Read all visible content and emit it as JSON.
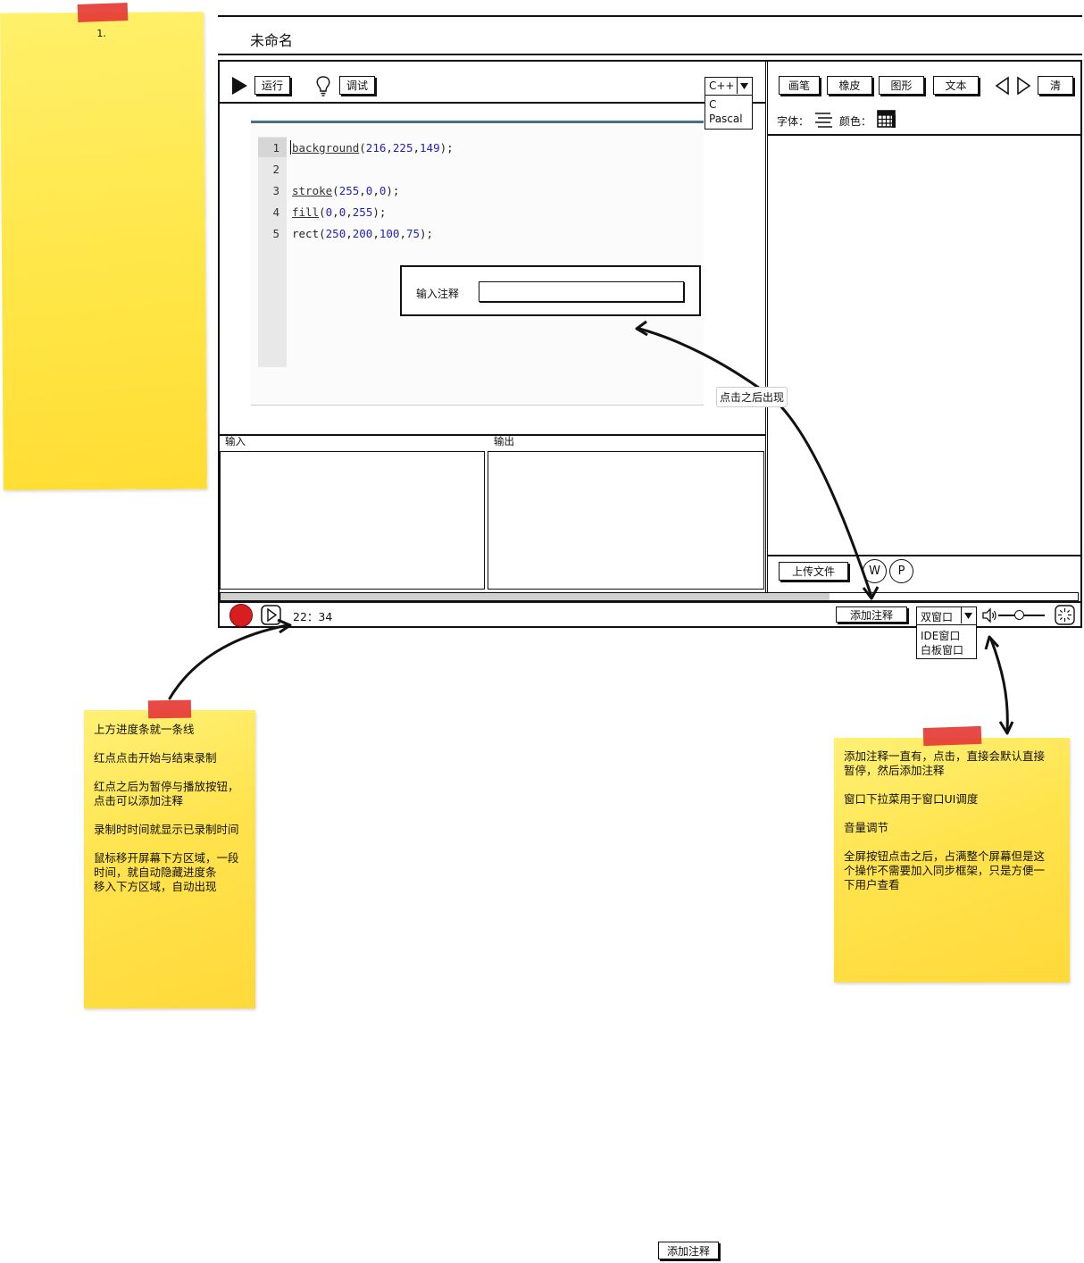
{
  "page_title": "未命名",
  "toolbar": {
    "run_label": "运行",
    "debug_label": "调试",
    "language_selected": "C++",
    "language_options": [
      "C",
      "Pascal"
    ]
  },
  "editor": {
    "line_numbers": [
      "1",
      "2",
      "3",
      "4",
      "5"
    ],
    "lines": [
      [
        {
          "t": "background",
          "c": "fn"
        },
        {
          "t": "(",
          "c": "p"
        },
        {
          "t": "216",
          "c": "num"
        },
        {
          "t": ",",
          "c": "p"
        },
        {
          "t": "225",
          "c": "num"
        },
        {
          "t": ",",
          "c": "p"
        },
        {
          "t": "149",
          "c": "num"
        },
        {
          "t": ");",
          "c": "p"
        }
      ],
      [],
      [
        {
          "t": "stroke",
          "c": "fn"
        },
        {
          "t": "(",
          "c": "p"
        },
        {
          "t": "255",
          "c": "num"
        },
        {
          "t": ",",
          "c": "p"
        },
        {
          "t": "0",
          "c": "num"
        },
        {
          "t": ",",
          "c": "p"
        },
        {
          "t": "0",
          "c": "num"
        },
        {
          "t": ");",
          "c": "p"
        }
      ],
      [
        {
          "t": "fill",
          "c": "fn"
        },
        {
          "t": "(",
          "c": "p"
        },
        {
          "t": "0",
          "c": "num"
        },
        {
          "t": ",",
          "c": "p"
        },
        {
          "t": "0",
          "c": "num"
        },
        {
          "t": ",",
          "c": "p"
        },
        {
          "t": "255",
          "c": "num"
        },
        {
          "t": ");",
          "c": "p"
        }
      ],
      [
        {
          "t": "rect",
          "c": "p"
        },
        {
          "t": "(",
          "c": "p"
        },
        {
          "t": "250",
          "c": "num"
        },
        {
          "t": ",",
          "c": "p"
        },
        {
          "t": "200",
          "c": "num"
        },
        {
          "t": ",",
          "c": "p"
        },
        {
          "t": "100",
          "c": "num"
        },
        {
          "t": ",",
          "c": "p"
        },
        {
          "t": "75",
          "c": "num"
        },
        {
          "t": ");",
          "c": "p"
        }
      ]
    ]
  },
  "annotation_popup": {
    "label": "输入注释",
    "value": ""
  },
  "callout_appear": "点击之后出现",
  "panes": {
    "input_label": "输入",
    "output_label": "输出"
  },
  "whiteboard": {
    "tools": [
      "画笔",
      "橡皮",
      "图形",
      "文本"
    ],
    "clear_label": "清",
    "font_label": "字体：",
    "color_label": "颜色：",
    "upload_label": "上传文件",
    "w_label": "W",
    "p_label": "P"
  },
  "recorder": {
    "time": "22：34",
    "add_note_label": "添加注释",
    "window_selected": "双窗口",
    "window_options": [
      "IDE窗口",
      "白板窗口"
    ],
    "progress": 0.71
  },
  "notes": {
    "top_left": "1.",
    "bottom_left": "上方进度条就一条线\n\n红点点击开始与结束录制\n\n红点之后为暂停与播放按钮，\n点击可以添加注释\n\n录制时时间就显示已录制时间\n\n鼠标移开屏幕下方区域，一段\n时间，就自动隐藏进度条\n移入下方区域，自动出现",
    "bottom_right": "添加注释一直有，点击，直接会默认直接\n暂停，然后添加注释\n\n窗口下拉菜用于窗口UI调度\n\n音量调节\n\n全屏按钮点击之后，占满整个屏幕但是这\n个操作不需要加入同步框架，只是方便一\n下用户查看"
  },
  "bottom_button_label": "添加注释"
}
